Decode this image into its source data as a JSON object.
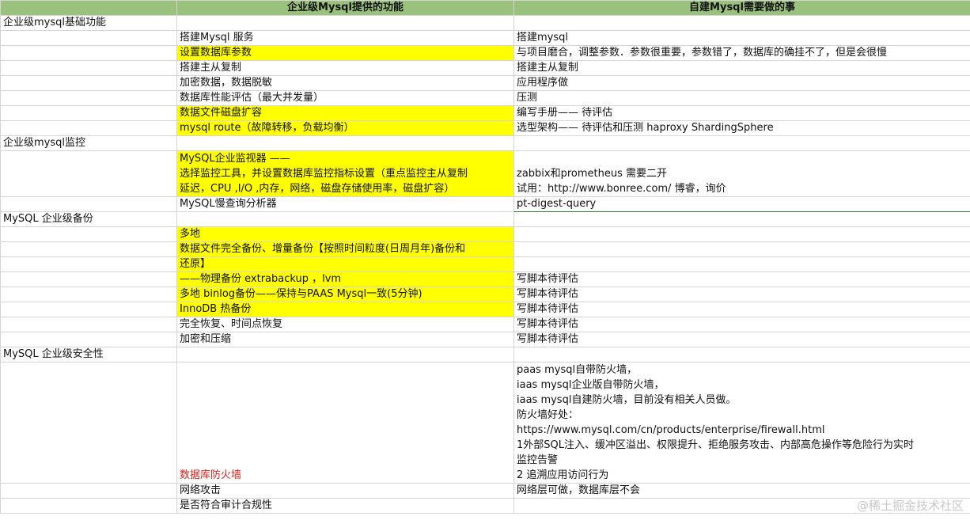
{
  "header": {
    "col2": "企业级Mysql提供的功能",
    "col3": "自建Mysql需要做的事"
  },
  "sections": [
    {
      "title": "企业级mysql基础功能",
      "rows": [
        {
          "feature": "搭建Mysql 服务",
          "todo": "搭建mysql",
          "yellow": false
        },
        {
          "feature": "设置数据库参数",
          "todo": "与项目磨合，调整参数．参数很重要，参数错了，数据库的确挂不了，但是会很慢",
          "yellow": true
        },
        {
          "feature": "搭建主从复制",
          "todo": "搭建主从复制",
          "yellow": false
        },
        {
          "feature": "加密数据，数据脱敏",
          "todo": "应用程序做",
          "yellow": false
        },
        {
          "feature": "数据库性能评估（最大并发量）",
          "todo": "压测",
          "yellow": false
        },
        {
          "feature": "数据文件磁盘扩容",
          "todo": "编写手册—— 待评估",
          "yellow": true
        },
        {
          "feature": "mysql route（故障转移，负载均衡）",
          "todo": "选型架构—— 待评估和压测       haproxy  ShardingSphere",
          "yellow": true
        }
      ]
    },
    {
      "title": "企业级mysql监控",
      "monitor": {
        "feature_lines": [
          "MySQL企业监视器 ——",
          "选择监控工具，并设置数据库监控指标设置（重点监控主从复制",
          "延迟，CPU ,I/O ,内存，网络，磁盘存储使用率，磁盘扩容）"
        ],
        "todo_lines": [
          "zabbix和prometheus 需要二开",
          "试用：http://www.bonree.com/  博睿，询价"
        ]
      },
      "slow_query": {
        "feature": "MySQL慢查询分析器",
        "todo": "pt-digest-query"
      }
    },
    {
      "title": "MySQL 企业级备份",
      "rows": [
        {
          "feature": "多地",
          "todo": "",
          "yellow": true
        },
        {
          "feature": "数据文件完全备份、增量备份【按照时间粒度(日周月年)备份和",
          "todo": "",
          "yellow": true
        },
        {
          "feature": "还原】",
          "todo": "",
          "yellow": true
        },
        {
          "feature": "——物理备份 extrabackup  ，lvm",
          "todo": "写脚本待评估",
          "yellow": true
        },
        {
          "feature": "多地 binlog备份——保持与PAAS Mysql一致(5分钟)",
          "todo": "写脚本待评估",
          "yellow": true
        },
        {
          "feature": "InnoDB 热备份",
          "todo": "写脚本待评估",
          "yellow": true
        },
        {
          "feature": "完全恢复、时间点恢复",
          "todo": "写脚本待评估",
          "yellow": false
        },
        {
          "feature": "加密和压缩",
          "todo": "写脚本待评估",
          "yellow": false
        }
      ]
    },
    {
      "title": "MySQL 企业级安全性",
      "firewall": {
        "feature": "数据库防火墙",
        "todo_lines": [
          "paas mysql自带防火墙，",
          "iaas mysql企业版自带防火墙，",
          "iaas mysql自建防火墙，目前没有相关人员做。",
          "防火墙好处：",
          "https://www.mysql.com/cn/products/enterprise/firewall.html",
          "1外部SQL注入、缓冲区溢出、权限提升、拒绝服务攻击、内部高危操作等危险行为实时",
          "监控告警",
          "2 追溯应用访问行为"
        ]
      },
      "rows": [
        {
          "feature": "网络攻击",
          "todo": "网络层可做，数据库层不会",
          "yellow": false
        },
        {
          "feature": "是否符合审计合规性",
          "todo": "",
          "yellow": false
        }
      ]
    }
  ],
  "watermark": "@稀土掘金技术社区"
}
